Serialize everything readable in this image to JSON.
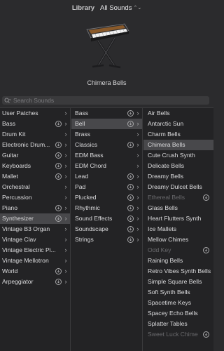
{
  "header": {
    "library_label": "Library",
    "selector_label": "All Sounds",
    "selector_icon": "up-down-chevron-icon"
  },
  "patch": {
    "name": "Chimera Bells",
    "image_icon": "keyboard-on-stand-icon"
  },
  "search": {
    "placeholder": "Search Sounds",
    "value": ""
  },
  "categories": [
    {
      "label": "User Patches",
      "download": false,
      "arrow": true,
      "selected": false
    },
    {
      "label": "Bass",
      "download": true,
      "arrow": true,
      "selected": false
    },
    {
      "label": "Drum Kit",
      "download": false,
      "arrow": true,
      "selected": false
    },
    {
      "label": "Electronic Drum...",
      "download": true,
      "arrow": true,
      "selected": false
    },
    {
      "label": "Guitar",
      "download": true,
      "arrow": true,
      "selected": false
    },
    {
      "label": "Keyboards",
      "download": true,
      "arrow": true,
      "selected": false
    },
    {
      "label": "Mallet",
      "download": true,
      "arrow": true,
      "selected": false
    },
    {
      "label": "Orchestral",
      "download": false,
      "arrow": true,
      "selected": false
    },
    {
      "label": "Percussion",
      "download": false,
      "arrow": true,
      "selected": false
    },
    {
      "label": "Piano",
      "download": true,
      "arrow": true,
      "selected": false
    },
    {
      "label": "Synthesizer",
      "download": true,
      "arrow": true,
      "selected": true
    },
    {
      "label": "Vintage B3 Organ",
      "download": false,
      "arrow": true,
      "selected": false
    },
    {
      "label": "Vintage Clav",
      "download": false,
      "arrow": true,
      "selected": false
    },
    {
      "label": "Vintage Electric Pi...",
      "download": false,
      "arrow": true,
      "selected": false
    },
    {
      "label": "Vintage Mellotron",
      "download": false,
      "arrow": true,
      "selected": false
    },
    {
      "label": "World",
      "download": true,
      "arrow": true,
      "selected": false
    },
    {
      "label": "Arpeggiator",
      "download": true,
      "arrow": true,
      "selected": false
    }
  ],
  "subcategories": [
    {
      "label": "Bass",
      "download": true,
      "arrow": true,
      "selected": false
    },
    {
      "label": "Bell",
      "download": true,
      "arrow": true,
      "selected": true
    },
    {
      "label": "Brass",
      "download": false,
      "arrow": true,
      "selected": false
    },
    {
      "label": "Classics",
      "download": true,
      "arrow": true,
      "selected": false
    },
    {
      "label": "EDM Bass",
      "download": false,
      "arrow": true,
      "selected": false
    },
    {
      "label": "EDM Chord",
      "download": false,
      "arrow": true,
      "selected": false
    },
    {
      "label": "Lead",
      "download": true,
      "arrow": true,
      "selected": false
    },
    {
      "label": "Pad",
      "download": true,
      "arrow": true,
      "selected": false
    },
    {
      "label": "Plucked",
      "download": true,
      "arrow": true,
      "selected": false
    },
    {
      "label": "Rhythmic",
      "download": true,
      "arrow": true,
      "selected": false
    },
    {
      "label": "Sound Effects",
      "download": true,
      "arrow": true,
      "selected": false
    },
    {
      "label": "Soundscape",
      "download": true,
      "arrow": true,
      "selected": false
    },
    {
      "label": "Strings",
      "download": true,
      "arrow": true,
      "selected": false
    }
  ],
  "patches": [
    {
      "label": "Air Bells",
      "download": false,
      "dim": false,
      "selected": false
    },
    {
      "label": "Antarctic Sun",
      "download": false,
      "dim": false,
      "selected": false
    },
    {
      "label": "Charm Bells",
      "download": false,
      "dim": false,
      "selected": false
    },
    {
      "label": "Chimera Bells",
      "download": false,
      "dim": false,
      "selected": true
    },
    {
      "label": "Cute Crush Synth",
      "download": false,
      "dim": false,
      "selected": false
    },
    {
      "label": "Delicate Bells",
      "download": false,
      "dim": false,
      "selected": false
    },
    {
      "label": "Dreamy Bells",
      "download": false,
      "dim": false,
      "selected": false
    },
    {
      "label": "Dreamy Dulcet Bells",
      "download": false,
      "dim": false,
      "selected": false
    },
    {
      "label": "Ethereal Bells",
      "download": true,
      "dim": true,
      "selected": false
    },
    {
      "label": "Glass Bells",
      "download": false,
      "dim": false,
      "selected": false
    },
    {
      "label": "Heart Flutters Synth",
      "download": false,
      "dim": false,
      "selected": false
    },
    {
      "label": "Ice Mallets",
      "download": false,
      "dim": false,
      "selected": false
    },
    {
      "label": "Mellow Chimes",
      "download": false,
      "dim": false,
      "selected": false
    },
    {
      "label": "Odd Key",
      "download": true,
      "dim": true,
      "selected": false
    },
    {
      "label": "Raining Bells",
      "download": false,
      "dim": false,
      "selected": false
    },
    {
      "label": "Retro Vibes Synth Bells",
      "download": false,
      "dim": false,
      "selected": false
    },
    {
      "label": "Simple Square Bells",
      "download": false,
      "dim": false,
      "selected": false
    },
    {
      "label": "Soft Synth Bells",
      "download": false,
      "dim": false,
      "selected": false
    },
    {
      "label": "Spacetime Keys",
      "download": false,
      "dim": false,
      "selected": false
    },
    {
      "label": "Spacey Echo Bells",
      "download": false,
      "dim": false,
      "selected": false
    },
    {
      "label": "Splatter Tables",
      "download": false,
      "dim": false,
      "selected": false
    },
    {
      "label": "Sweet Luck Chime",
      "download": true,
      "dim": true,
      "selected": false
    }
  ],
  "icons": {
    "download": "download-circle-icon",
    "arrow": "chevron-right-icon",
    "search": "search-icon"
  },
  "colors": {
    "background": "#2b2b2d",
    "selected_row": "#48484b",
    "dim_text": "#6a6a6d"
  }
}
